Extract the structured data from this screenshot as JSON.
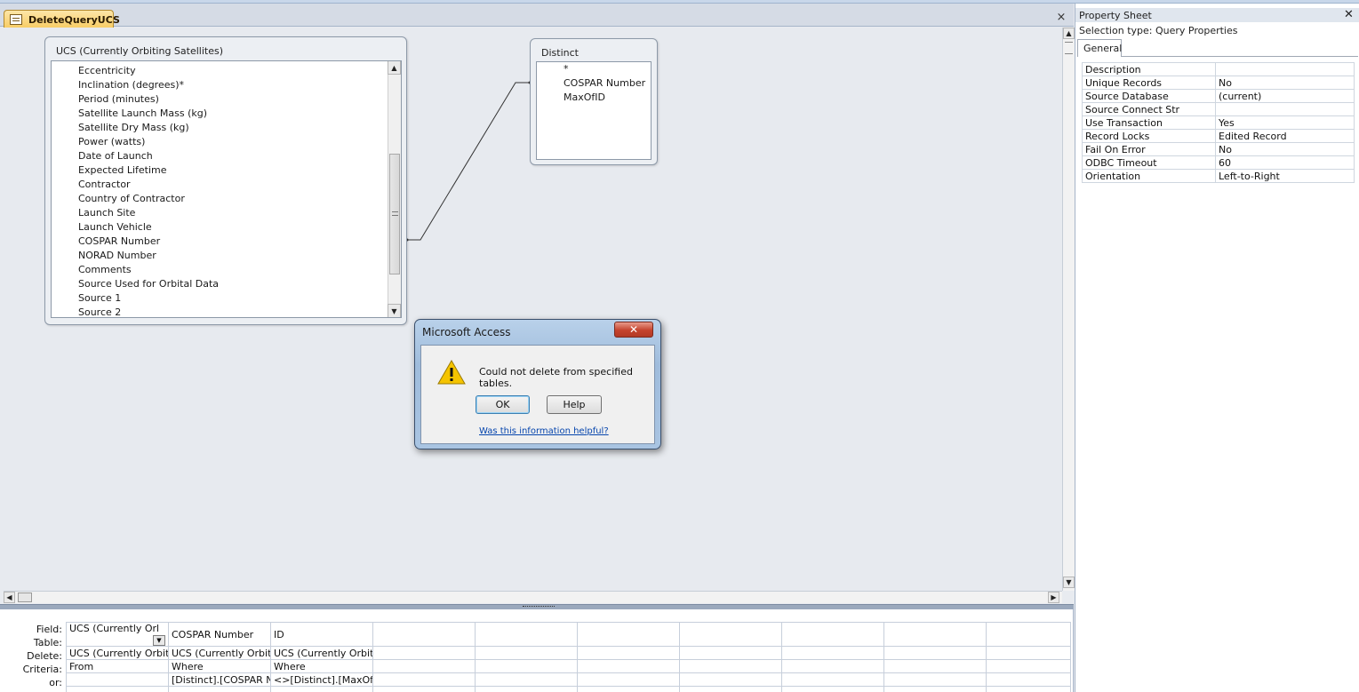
{
  "document": {
    "tab_title": "DeleteQueryUCS",
    "close_glyph": "×"
  },
  "tables": {
    "ucs": {
      "title": "UCS (Currently Orbiting Satellites)",
      "fields": [
        "Eccentricity",
        "Inclination (degrees)*",
        "Period (minutes)",
        "Satellite Launch Mass (kg)",
        "Satellite Dry Mass (kg)",
        "Power (watts)",
        "Date of Launch",
        "Expected Lifetime",
        "Contractor",
        "Country of Contractor",
        "Launch Site",
        "Launch Vehicle",
        "COSPAR Number",
        "NORAD Number",
        "Comments",
        "Source Used for Orbital Data",
        "Source 1",
        "Source 2"
      ]
    },
    "distinct": {
      "title": "Distinct",
      "fields": [
        "*",
        "COSPAR Number",
        "MaxOfID"
      ]
    }
  },
  "grid": {
    "row_labels": [
      "Field:",
      "Table:",
      "Delete:",
      "Criteria:",
      "or:"
    ],
    "columns": [
      {
        "field": "UCS (Currently Orl",
        "table": "UCS (Currently Orbitir",
        "delete": "From",
        "criteria": "",
        "or": ""
      },
      {
        "field": "COSPAR Number",
        "table": "UCS (Currently Orbitir",
        "delete": "Where",
        "criteria": "[Distinct].[COSPAR Nu",
        "or": ""
      },
      {
        "field": "ID",
        "table": "UCS (Currently Orbitir",
        "delete": "Where",
        "criteria": "<>[Distinct].[MaxOfID",
        "or": ""
      }
    ]
  },
  "property_sheet": {
    "title": "Property Sheet",
    "close_glyph": "✕",
    "selection_type": "Selection type:  Query Properties",
    "tab": "General",
    "rows": [
      {
        "name": "Description",
        "value": ""
      },
      {
        "name": "Unique Records",
        "value": "No"
      },
      {
        "name": "Source Database",
        "value": "(current)"
      },
      {
        "name": "Source Connect Str",
        "value": ""
      },
      {
        "name": "Use Transaction",
        "value": "Yes"
      },
      {
        "name": "Record Locks",
        "value": "Edited Record"
      },
      {
        "name": "Fail On Error",
        "value": "No"
      },
      {
        "name": "ODBC Timeout",
        "value": "60"
      },
      {
        "name": "Orientation",
        "value": "Left-to-Right"
      }
    ]
  },
  "dialog": {
    "title": "Microsoft Access",
    "close_glyph": "✕",
    "message": "Could not delete from specified tables.",
    "ok_label": "OK",
    "help_label": "Help",
    "link_text": "Was this information helpful?"
  }
}
